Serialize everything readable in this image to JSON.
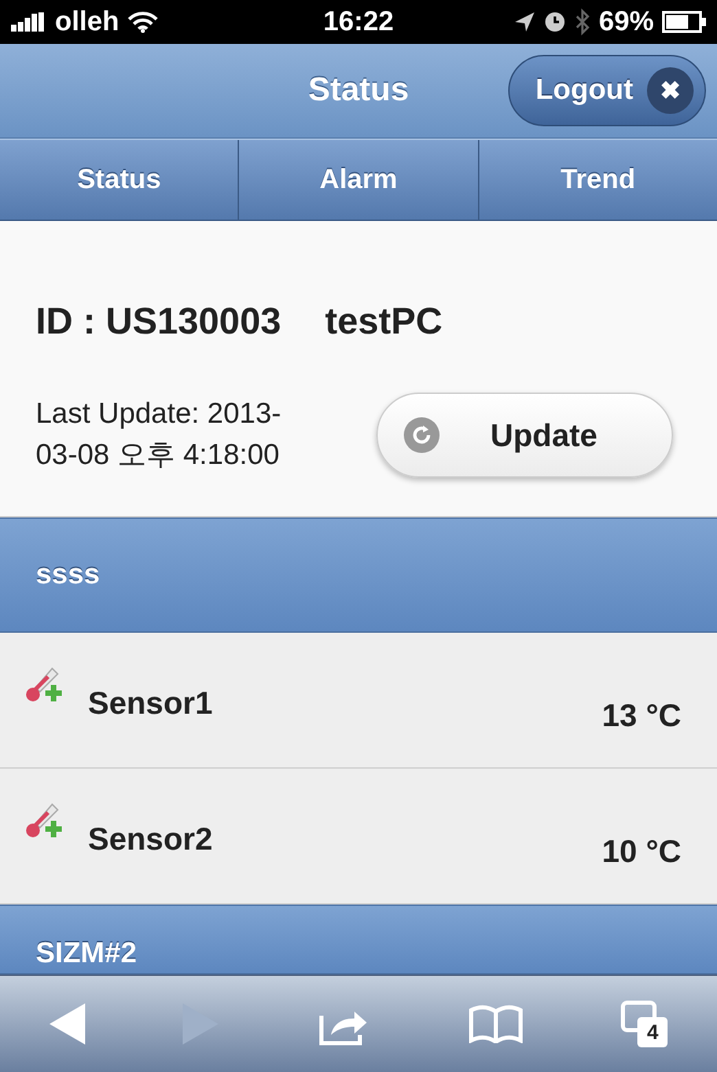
{
  "status_bar": {
    "carrier": "olleh",
    "time": "16:22",
    "battery": "69%"
  },
  "header": {
    "title": "Status",
    "logout": "Logout",
    "logout_icon": "✖"
  },
  "tabs": [
    {
      "label": "Status"
    },
    {
      "label": "Alarm"
    },
    {
      "label": "Trend"
    }
  ],
  "info": {
    "id": "ID : US130003",
    "name": "testPC",
    "last_update": "Last Update: 2013-03-08 오후 4:18:00",
    "update_button": "Update"
  },
  "groups": [
    {
      "title": "ssss",
      "sensors": [
        {
          "name": "Sensor1",
          "value": "13 °C"
        },
        {
          "name": "Sensor2",
          "value": "10 °C"
        }
      ]
    },
    {
      "title": "SIZM#2"
    }
  ],
  "toolbar": {
    "back_disabled": false,
    "forward_disabled": true,
    "tab_count": "4"
  }
}
